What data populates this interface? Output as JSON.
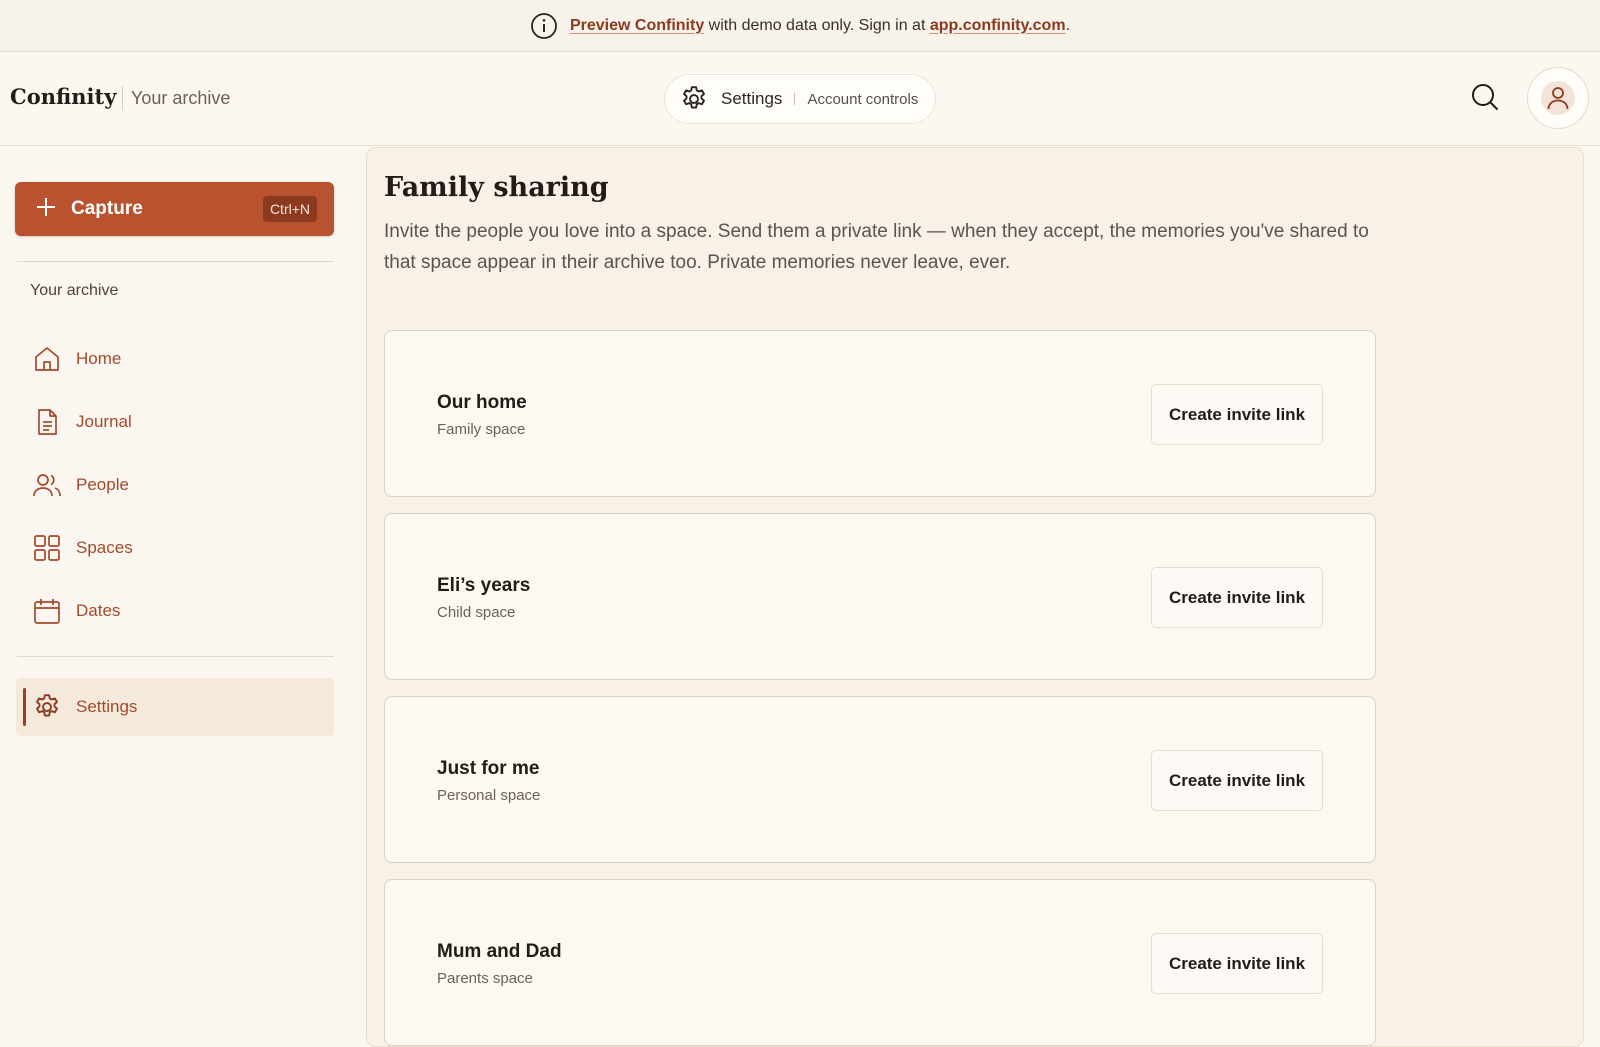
{
  "banner": {
    "link_text": "Preview Confinity",
    "middle_text": "with demo data only. Sign in at",
    "url_text": "app.confinity.com",
    "end_text": "."
  },
  "header": {
    "brand": "Confinity",
    "brand_sub": "Your archive",
    "pill_title": "Settings",
    "pill_sub": "Account controls"
  },
  "sidebar": {
    "capture_label": "Capture",
    "capture_shortcut": "Ctrl+N",
    "section_label": "Your archive",
    "items": [
      {
        "label": "Home",
        "icon": "home-icon"
      },
      {
        "label": "Journal",
        "icon": "document-icon"
      },
      {
        "label": "People",
        "icon": "people-icon"
      },
      {
        "label": "Spaces",
        "icon": "grid-icon"
      },
      {
        "label": "Dates",
        "icon": "calendar-icon"
      }
    ],
    "settings_label": "Settings"
  },
  "main": {
    "title": "Family sharing",
    "description": "Invite the people you love into a space. Send them a private link — when they accept, the memories you've shared to that space appear in their archive too. Private memories never leave, ever.",
    "spaces": [
      {
        "name": "Our home",
        "type": "Family space",
        "button": "Create invite link"
      },
      {
        "name": "Eli’s years",
        "type": "Child space",
        "button": "Create invite link"
      },
      {
        "name": "Just for me",
        "type": "Personal space",
        "button": "Create invite link"
      },
      {
        "name": "Mum and Dad",
        "type": "Parents space",
        "button": "Create invite link"
      }
    ]
  },
  "colors": {
    "accent": "#b9532f",
    "accent_dark": "#8c3a1f",
    "nav_text": "#a34a2b",
    "background": "#fbf7f0"
  }
}
